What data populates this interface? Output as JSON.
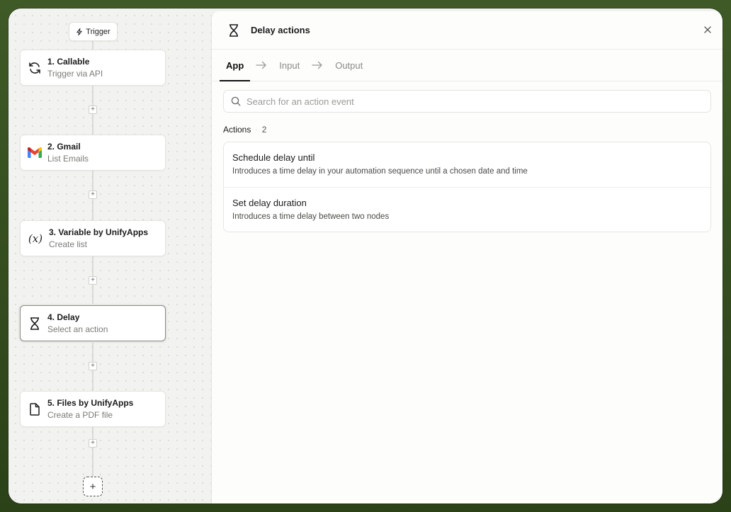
{
  "canvas": {
    "trigger_label": "Trigger",
    "nodes": [
      {
        "title": "1. Callable",
        "subtitle": "Trigger via API"
      },
      {
        "title": "2. Gmail",
        "subtitle": "List Emails"
      },
      {
        "title": "3. Variable by UnifyApps",
        "subtitle": "Create list",
        "icon_text": "(x)"
      },
      {
        "title": "4. Delay",
        "subtitle": "Select an action"
      },
      {
        "title": "5. Files by UnifyApps",
        "subtitle": "Create a PDF file"
      }
    ],
    "plus_symbol": "+",
    "add_symbol": "+"
  },
  "panel": {
    "title": "Delay actions",
    "tabs": [
      {
        "label": "App"
      },
      {
        "label": "Input"
      },
      {
        "label": "Output"
      }
    ],
    "search": {
      "placeholder": "Search for an action event"
    },
    "section": {
      "label": "Actions",
      "separator": "·",
      "count": "2"
    },
    "actions": [
      {
        "title": "Schedule delay until",
        "description": "Introduces a time delay in your automation sequence until a chosen date and time"
      },
      {
        "title": "Set delay duration",
        "description": "Introduces a time delay between two nodes"
      }
    ]
  },
  "colors": {
    "background": "#3f5a26",
    "gmail_red": "#EA4335",
    "gmail_blue": "#4285F4",
    "gmail_green": "#34A853",
    "gmail_yellow": "#FBBC05"
  }
}
